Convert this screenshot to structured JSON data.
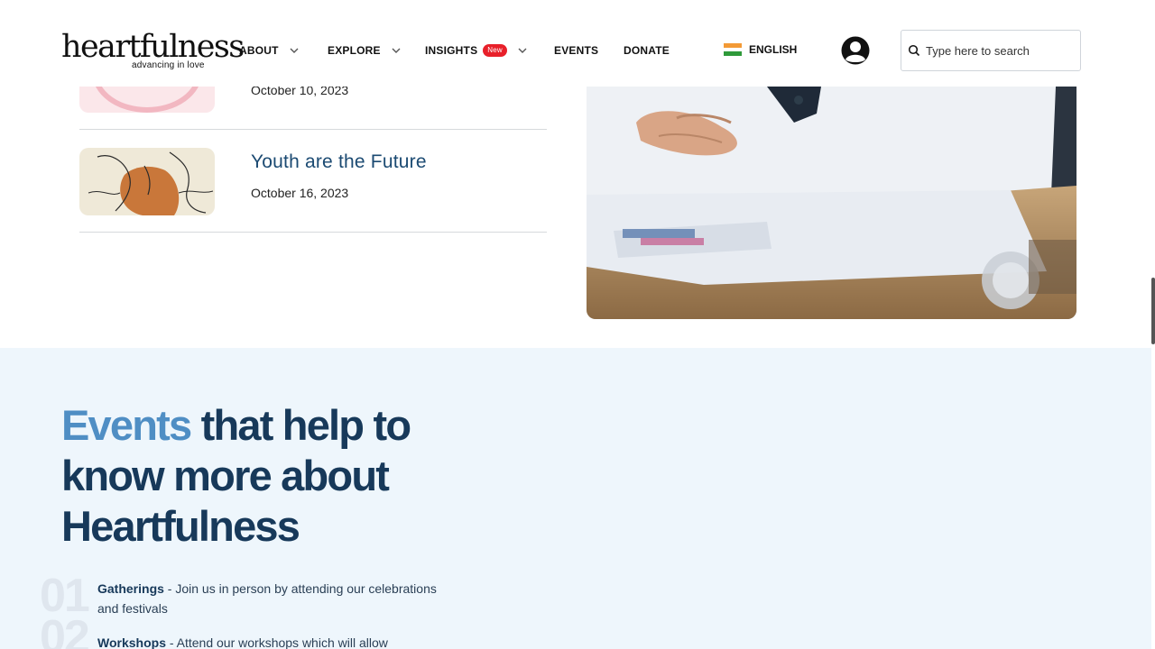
{
  "logo": {
    "name": "heartfulness",
    "tagline": "advancing in love"
  },
  "nav": [
    {
      "label": "ABOUT",
      "dropdown": true
    },
    {
      "label": "EXPLORE",
      "dropdown": true
    },
    {
      "label": "INSIGHTS",
      "badge": "New",
      "dropdown": true
    },
    {
      "label": "EVENTS",
      "dropdown": false
    },
    {
      "label": "DONATE",
      "dropdown": false
    }
  ],
  "language": {
    "label": "ENGLISH",
    "flag_icon": "india-flag-icon"
  },
  "search": {
    "placeholder": "Type here to search",
    "value": ""
  },
  "articles": [
    {
      "title": "",
      "date": "October 10, 2023"
    },
    {
      "title": "Youth are the Future",
      "date": "October 16, 2023"
    }
  ],
  "events_section": {
    "heading_highlight": "Events",
    "heading_rest": "that help to know more about Heartfulness",
    "items": [
      {
        "number": "01",
        "title": "Gatherings",
        "text": " - Join us in person by attending our celebrations and festivals"
      },
      {
        "number": "02",
        "title": "Workshops",
        "text": " - Attend our workshops which will allow"
      }
    ]
  },
  "colors": {
    "accent_blue": "#4f8ec4",
    "heading_navy": "#17395a",
    "section_bg": "#eef6fc",
    "badge_red": "#e8202a"
  }
}
